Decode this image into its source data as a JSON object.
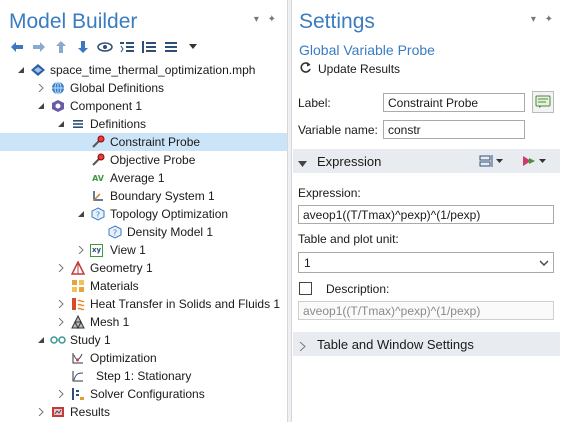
{
  "model_builder": {
    "title": "Model Builder",
    "toolbar": [
      {
        "name": "back-arrow-icon"
      },
      {
        "name": "forward-arrow-icon"
      },
      {
        "name": "up-arrow-icon"
      },
      {
        "name": "down-arrow-icon"
      },
      {
        "name": "show-icon"
      },
      {
        "name": "collapse-all-icon"
      },
      {
        "name": "expand-all-icon"
      },
      {
        "name": "list-menu-icon"
      },
      {
        "name": "dropdown-caret-icon"
      }
    ],
    "tree": [
      {
        "label": "space_time_thermal_optimization.mph",
        "icon": "model-file-icon"
      },
      {
        "label": "Global Definitions",
        "icon": "globe-icon"
      },
      {
        "label": "Component 1",
        "icon": "component-icon"
      },
      {
        "label": "Definitions",
        "icon": "definitions-icon"
      },
      {
        "label": "Constraint Probe",
        "icon": "probe-icon"
      },
      {
        "label": "Objective Probe",
        "icon": "probe-icon"
      },
      {
        "label": "Average 1",
        "icon": "average-icon",
        "icon_text": "AV"
      },
      {
        "label": "Boundary System 1",
        "icon": "coordinate-system-icon"
      },
      {
        "label": "Topology Optimization",
        "icon": "topology-optimization-icon"
      },
      {
        "label": "Density Model 1",
        "icon": "density-model-icon"
      },
      {
        "label": "View 1",
        "icon": "view-icon",
        "icon_text": "xy"
      },
      {
        "label": "Geometry 1",
        "icon": "geometry-icon"
      },
      {
        "label": "Materials",
        "icon": "materials-icon"
      },
      {
        "label": "Heat Transfer in Solids and Fluids 1",
        "icon": "heat-transfer-icon"
      },
      {
        "label": "Mesh 1",
        "icon": "mesh-icon"
      },
      {
        "label": "Study 1",
        "icon": "study-icon"
      },
      {
        "label": "Optimization",
        "icon": "optimization-icon"
      },
      {
        "label": "Step 1: Stationary",
        "icon": "stationary-step-icon"
      },
      {
        "label": "Solver Configurations",
        "icon": "solver-configurations-icon"
      },
      {
        "label": "Results",
        "icon": "results-icon"
      }
    ]
  },
  "settings": {
    "title": "Settings",
    "subtitle": "Global Variable Probe",
    "update_results": "Update Results",
    "label_caption": "Label:",
    "label_value": "Constraint Probe",
    "varname_caption": "Variable name:",
    "varname_value": "constr",
    "expression_section": "Expression",
    "expression_caption": "Expression:",
    "expression_value": "aveop1((T/Tmax)^pexp)^(1/pexp)",
    "unit_caption": "Table and plot unit:",
    "unit_value": "1",
    "description_caption": "Description:",
    "description_value": "aveop1((T/Tmax)^pexp)^(1/pexp)",
    "table_window_section": "Table and Window Settings"
  },
  "colors": {
    "title_blue": "#3a7cc1",
    "selection": "#cce4f7",
    "section_bar": "#e8ecf1"
  }
}
